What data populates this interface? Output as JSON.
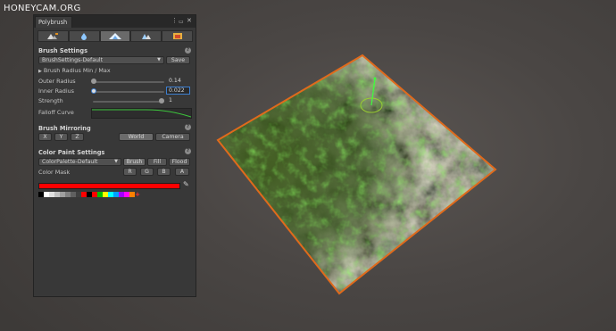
{
  "watermark": "HONEYCAM.ORG",
  "window": {
    "tab_title": "Polybrush"
  },
  "modes": [
    {
      "name": "sculpt",
      "icon": "sculpt-icon",
      "active": false
    },
    {
      "name": "smooth",
      "icon": "drop-icon",
      "active": false
    },
    {
      "name": "paint-vertex",
      "icon": "paint-icon",
      "active": true
    },
    {
      "name": "scatter",
      "icon": "scatter-icon",
      "active": false
    },
    {
      "name": "texture",
      "icon": "texture-icon",
      "active": false
    }
  ],
  "brush_settings": {
    "title": "Brush Settings",
    "preset": "BrushSettings-Default",
    "save_label": "Save",
    "radius_toggle_label": "Brush Radius Min / Max",
    "outer_radius_label": "Outer Radius",
    "outer_radius_value": "0.14",
    "outer_radius_fraction": 0.0,
    "inner_radius_label": "Inner Radius",
    "inner_radius_value": "0.022",
    "inner_radius_fraction": 0.0,
    "strength_label": "Strength",
    "strength_value": "1",
    "strength_fraction": 1.0,
    "falloff_label": "Falloff Curve"
  },
  "mirroring": {
    "title": "Brush Mirroring",
    "x_label": "X",
    "y_label": "Y",
    "z_label": "Z",
    "world_label": "World",
    "camera_label": "Camera",
    "selected_space": "World"
  },
  "color_paint": {
    "title": "Color Paint Settings",
    "palette": "ColorPalette-Default",
    "brush_label": "Brush",
    "fill_label": "Fill",
    "flood_label": "Flood",
    "mask_label": "Color Mask",
    "r_label": "R",
    "g_label": "G",
    "b_label": "B",
    "a_label": "A",
    "current_color": "#ff0000",
    "add_swatch_label": "+",
    "swatches": [
      "#000000",
      "#ffffff",
      "#e0e0e0",
      "#c0c0c0",
      "#a0a0a0",
      "#808080",
      "#606060",
      "#404040",
      "#ff0000",
      "#000000",
      "#ff0000",
      "#00c000",
      "#ffff00",
      "#00ffff",
      "#00a0ff",
      "#a000ff",
      "#ff00ff",
      "#ff8000"
    ]
  },
  "colors": {
    "selection_outline": "#e06a1c",
    "panel_bg": "#383838",
    "gizmo_green": "#3cff3c"
  }
}
